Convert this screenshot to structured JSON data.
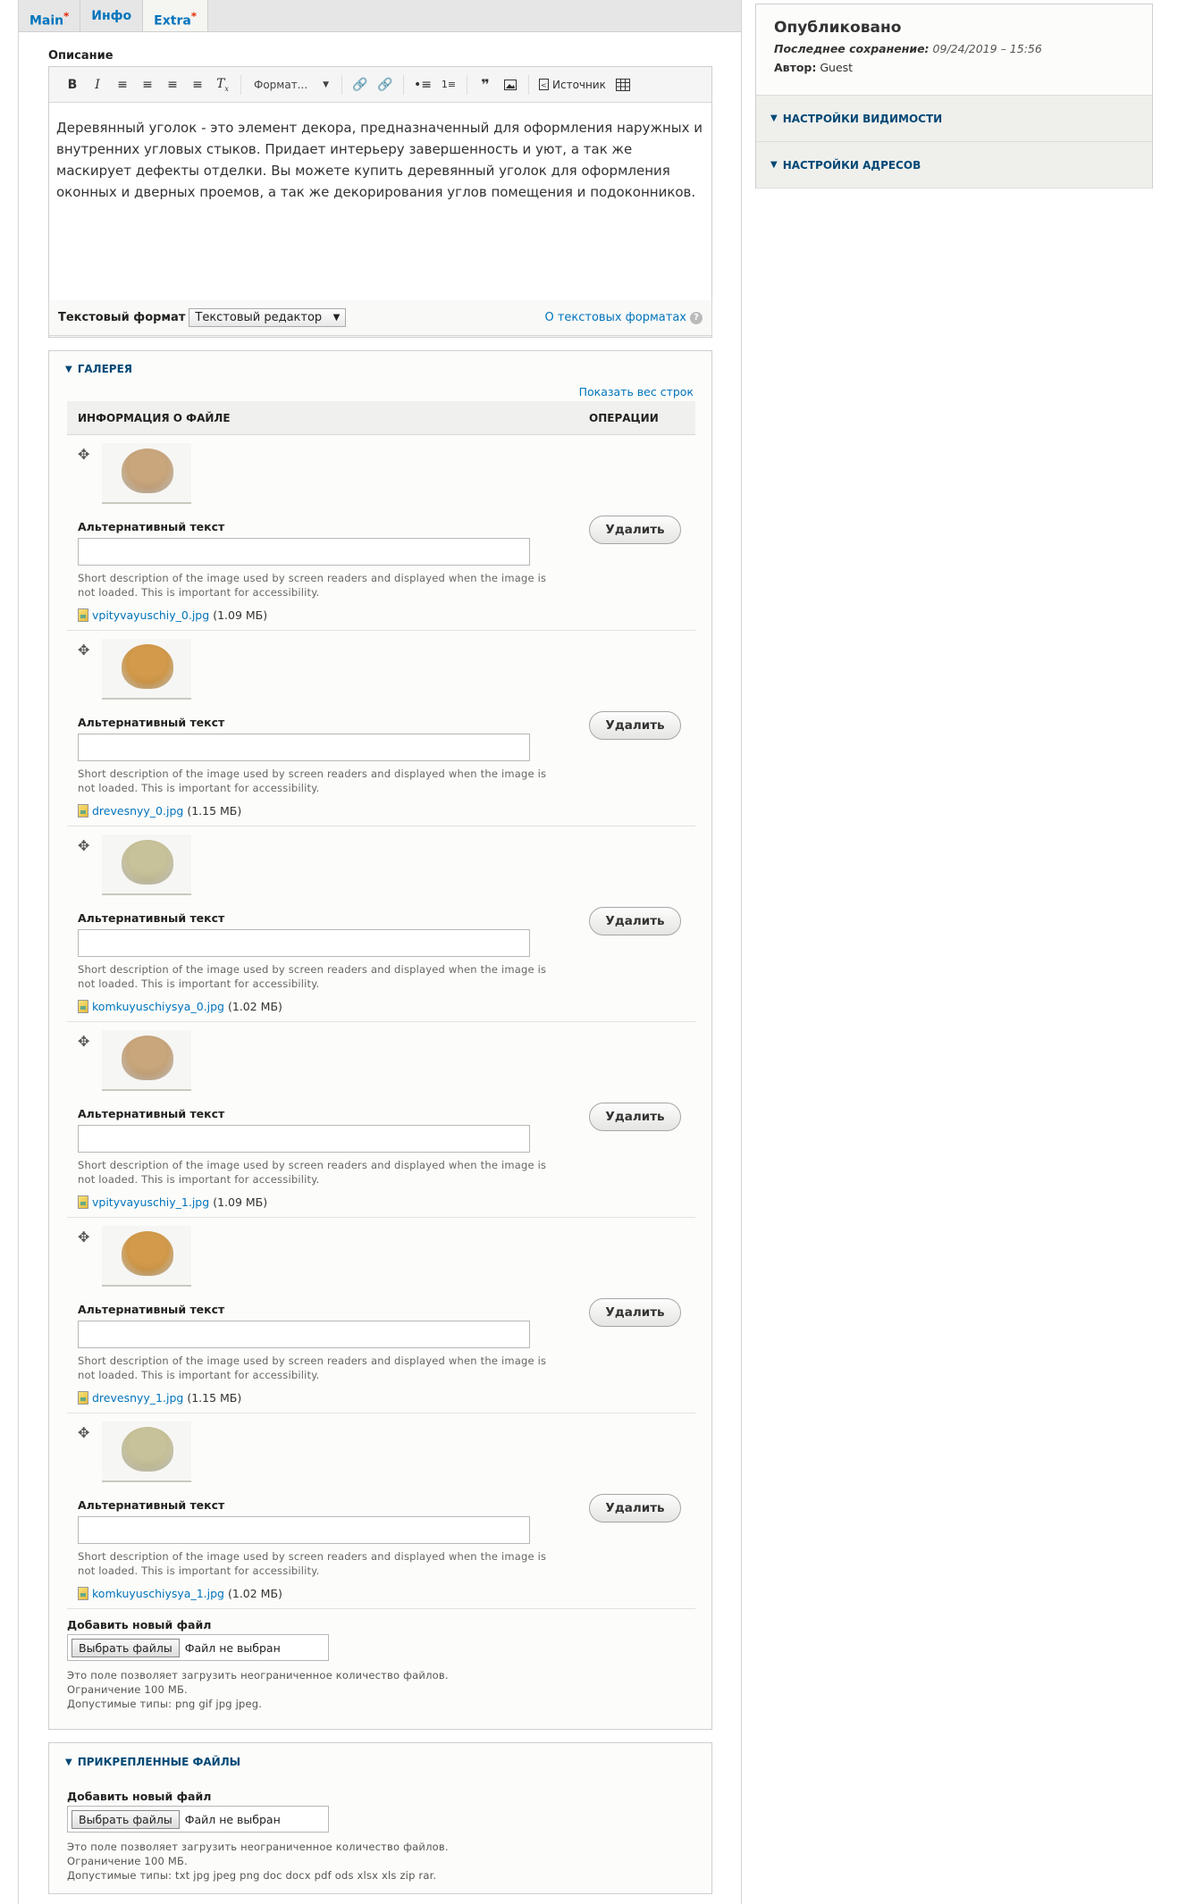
{
  "tabs": [
    {
      "label": "Main",
      "required": "*"
    },
    {
      "label": "Инфо",
      "required": ""
    },
    {
      "label": "Extra",
      "required": "*"
    }
  ],
  "description": {
    "label": "Описание",
    "toolbar": {
      "bold": "B",
      "italic": "I",
      "format_label": "Формат...",
      "source_label": "Источник",
      "quote": "❞"
    },
    "text": "Деревянный уголок - это элемент декора, предназначенный для оформления наружных и внутренних угловых стыков. Придает интерьеру завершенность и уют, а так же маскирует дефекты отделки. Вы можете купить деревянный уголок для оформления оконных и дверных проемов, а так же декорирования углов помещения и подоконников."
  },
  "text_format": {
    "label": "Текстовый формат",
    "selected": "Текстовый редактор",
    "about_link": "О текстовых форматах",
    "help": "?"
  },
  "gallery": {
    "title": "Галерея",
    "show_rows": "Показать вес строк",
    "col_file": "Информация о файле",
    "col_ops": "Операции",
    "alt_label": "Альтернативный текст",
    "alt_desc": "Short description of the image used by screen readers and displayed when the image is not loaded. This is important for accessibility.",
    "delete_label": "Удалить",
    "rows": [
      {
        "file": "vpityvayuschiy_0.jpg",
        "size": "(1.09 МБ)",
        "color": "#c9a67c"
      },
      {
        "file": "drevesnyy_0.jpg",
        "size": "(1.15 МБ)",
        "color": "#d29a4a"
      },
      {
        "file": "komkuyuschiysya_0.jpg",
        "size": "(1.02 МБ)",
        "color": "#c8c29a"
      },
      {
        "file": "vpityvayuschiy_1.jpg",
        "size": "(1.09 МБ)",
        "color": "#c9a67c"
      },
      {
        "file": "drevesnyy_1.jpg",
        "size": "(1.15 МБ)",
        "color": "#d29a4a"
      },
      {
        "file": "komkuyuschiysya_1.jpg",
        "size": "(1.02 МБ)",
        "color": "#c8c29a"
      }
    ],
    "add_file_label": "Добавить новый файл",
    "choose_label": "Выбрать файлы",
    "no_file": "Файл не выбран",
    "hint1": "Это поле позволяет загрузить неограниченное количество файлов.",
    "hint2": "Ограничение 100 МБ.",
    "hint3": "Допустимые типы: png gif jpg jpeg."
  },
  "attachments": {
    "title": "Прикрепленные файлы",
    "add_file_label": "Добавить новый файл",
    "choose_label": "Выбрать файлы",
    "no_file": "Файл не выбран",
    "hint1": "Это поле позволяет загрузить неограниченное количество файлов.",
    "hint2": "Ограничение 100 МБ.",
    "hint3": "Допустимые типы: txt jpg jpeg png doc docx pdf ods xlsx xls zip rar."
  },
  "sidebar": {
    "status": "Опубликовано",
    "last_saved_label": "Последнее сохранение:",
    "last_saved_value": "09/24/2019 – 15:56",
    "author_label": "Автор:",
    "author_value": "Guest",
    "visibility": "Настройки видимости",
    "addresses": "Настройки адресов"
  }
}
